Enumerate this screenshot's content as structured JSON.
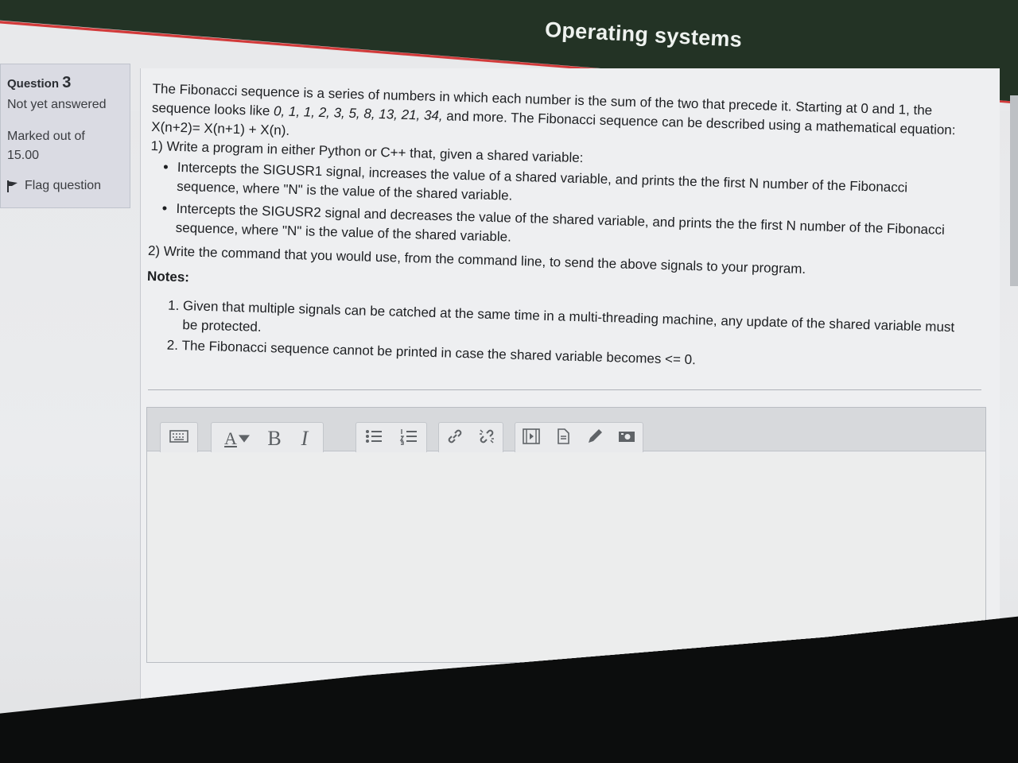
{
  "header": {
    "course_title": "Operating systems"
  },
  "info": {
    "question_label": "Question",
    "question_number": "3",
    "status": "Not yet answered",
    "marked_label": "Marked out of",
    "marked_value": "15.00",
    "flag_label": "Flag question"
  },
  "question": {
    "intro_1": "The Fibonacci sequence is a series of numbers in which each number is the sum of the two that precede it. Starting at 0 and 1, the sequence looks like ",
    "intro_sequence": "0, 1, 1, 2, 3, 5, 8, 13, 21, 34,",
    "intro_2": " and more. The Fibonacci sequence can be described using a mathematical equation: X(n+2)= X(n+1) + X(n).",
    "part1": "1) Write a program in either Python or C++ that, given a shared variable:",
    "bullets": [
      "Intercepts the SIGUSR1 signal, increases the value of a shared variable, and prints the the first N number of the Fibonacci sequence, where \"N\" is the value of the shared variable.",
      "Intercepts the SIGUSR2 signal and decreases the value of the shared variable, and prints the the first N number of the Fibonacci sequence, where \"N\" is the value of the shared variable."
    ],
    "part2": "2) Write the command that you would use, from the command line, to send the above signals to your program.",
    "notes_heading": "Notes:",
    "notes": [
      "Given that multiple signals can be catched at the same time in a multi-threading machine, any update of the shared variable must be protected.",
      "The Fibonacci sequence cannot be printed in case the shared variable becomes <= 0."
    ]
  },
  "editor": {
    "toolbar": {
      "bold_label": "B",
      "italic_label": "I",
      "font_color_label": "A",
      "icons": [
        "expand-toolbar-icon",
        "font-color-icon",
        "bold-icon",
        "italic-icon",
        "unordered-list-icon",
        "ordered-list-icon",
        "link-icon",
        "unlink-icon",
        "media-icon",
        "file-manager-icon",
        "draw-icon",
        "record-video-icon"
      ]
    },
    "value": ""
  }
}
